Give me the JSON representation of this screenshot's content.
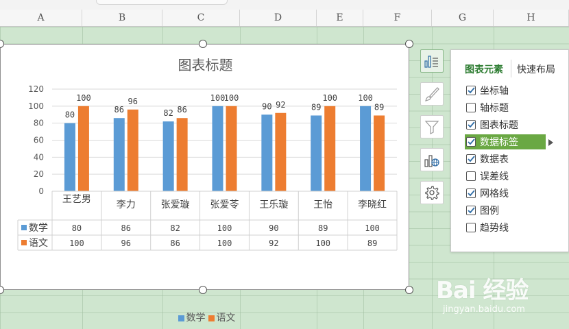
{
  "columns": [
    "A",
    "B",
    "C",
    "D",
    "E",
    "F",
    "G",
    "H"
  ],
  "chart_data": {
    "type": "bar",
    "title": "图表标题",
    "categories": [
      "王艺男",
      "李力",
      "张爱璇",
      "张爱苓",
      "王乐璇",
      "王怡",
      "李晓红"
    ],
    "series": [
      {
        "name": "数学",
        "values": [
          80,
          86,
          82,
          100,
          90,
          89,
          100
        ],
        "color": "#5b9bd5"
      },
      {
        "name": "语文",
        "values": [
          100,
          96,
          86,
          100,
          92,
          100,
          89
        ],
        "color": "#ed7d31"
      }
    ],
    "ylim": [
      0,
      120
    ],
    "yticks": [
      0,
      20,
      40,
      60,
      80,
      100,
      120
    ],
    "grid": true,
    "data_labels": true,
    "data_table": true,
    "legend": "bottom"
  },
  "panel": {
    "tab_active": "图表元素",
    "tab_other": "快速布局",
    "items": [
      {
        "label": "坐标轴",
        "checked": true
      },
      {
        "label": "轴标题",
        "checked": false
      },
      {
        "label": "图表标题",
        "checked": true
      },
      {
        "label": "数据标签",
        "checked": true,
        "selected": true
      },
      {
        "label": "数据表",
        "checked": true
      },
      {
        "label": "误差线",
        "checked": false
      },
      {
        "label": "网格线",
        "checked": true
      },
      {
        "label": "图例",
        "checked": true
      },
      {
        "label": "趋势线",
        "checked": false
      }
    ]
  },
  "tools": [
    {
      "icon": "chart-elements-icon",
      "active": true
    },
    {
      "icon": "brush-style-icon",
      "active": false
    },
    {
      "icon": "filter-icon",
      "active": false
    },
    {
      "icon": "chart-online-icon",
      "active": false
    },
    {
      "icon": "settings-gear-icon",
      "active": false
    }
  ],
  "watermark": {
    "big": "Bai 经验",
    "small": "jingyan.baidu.com"
  }
}
